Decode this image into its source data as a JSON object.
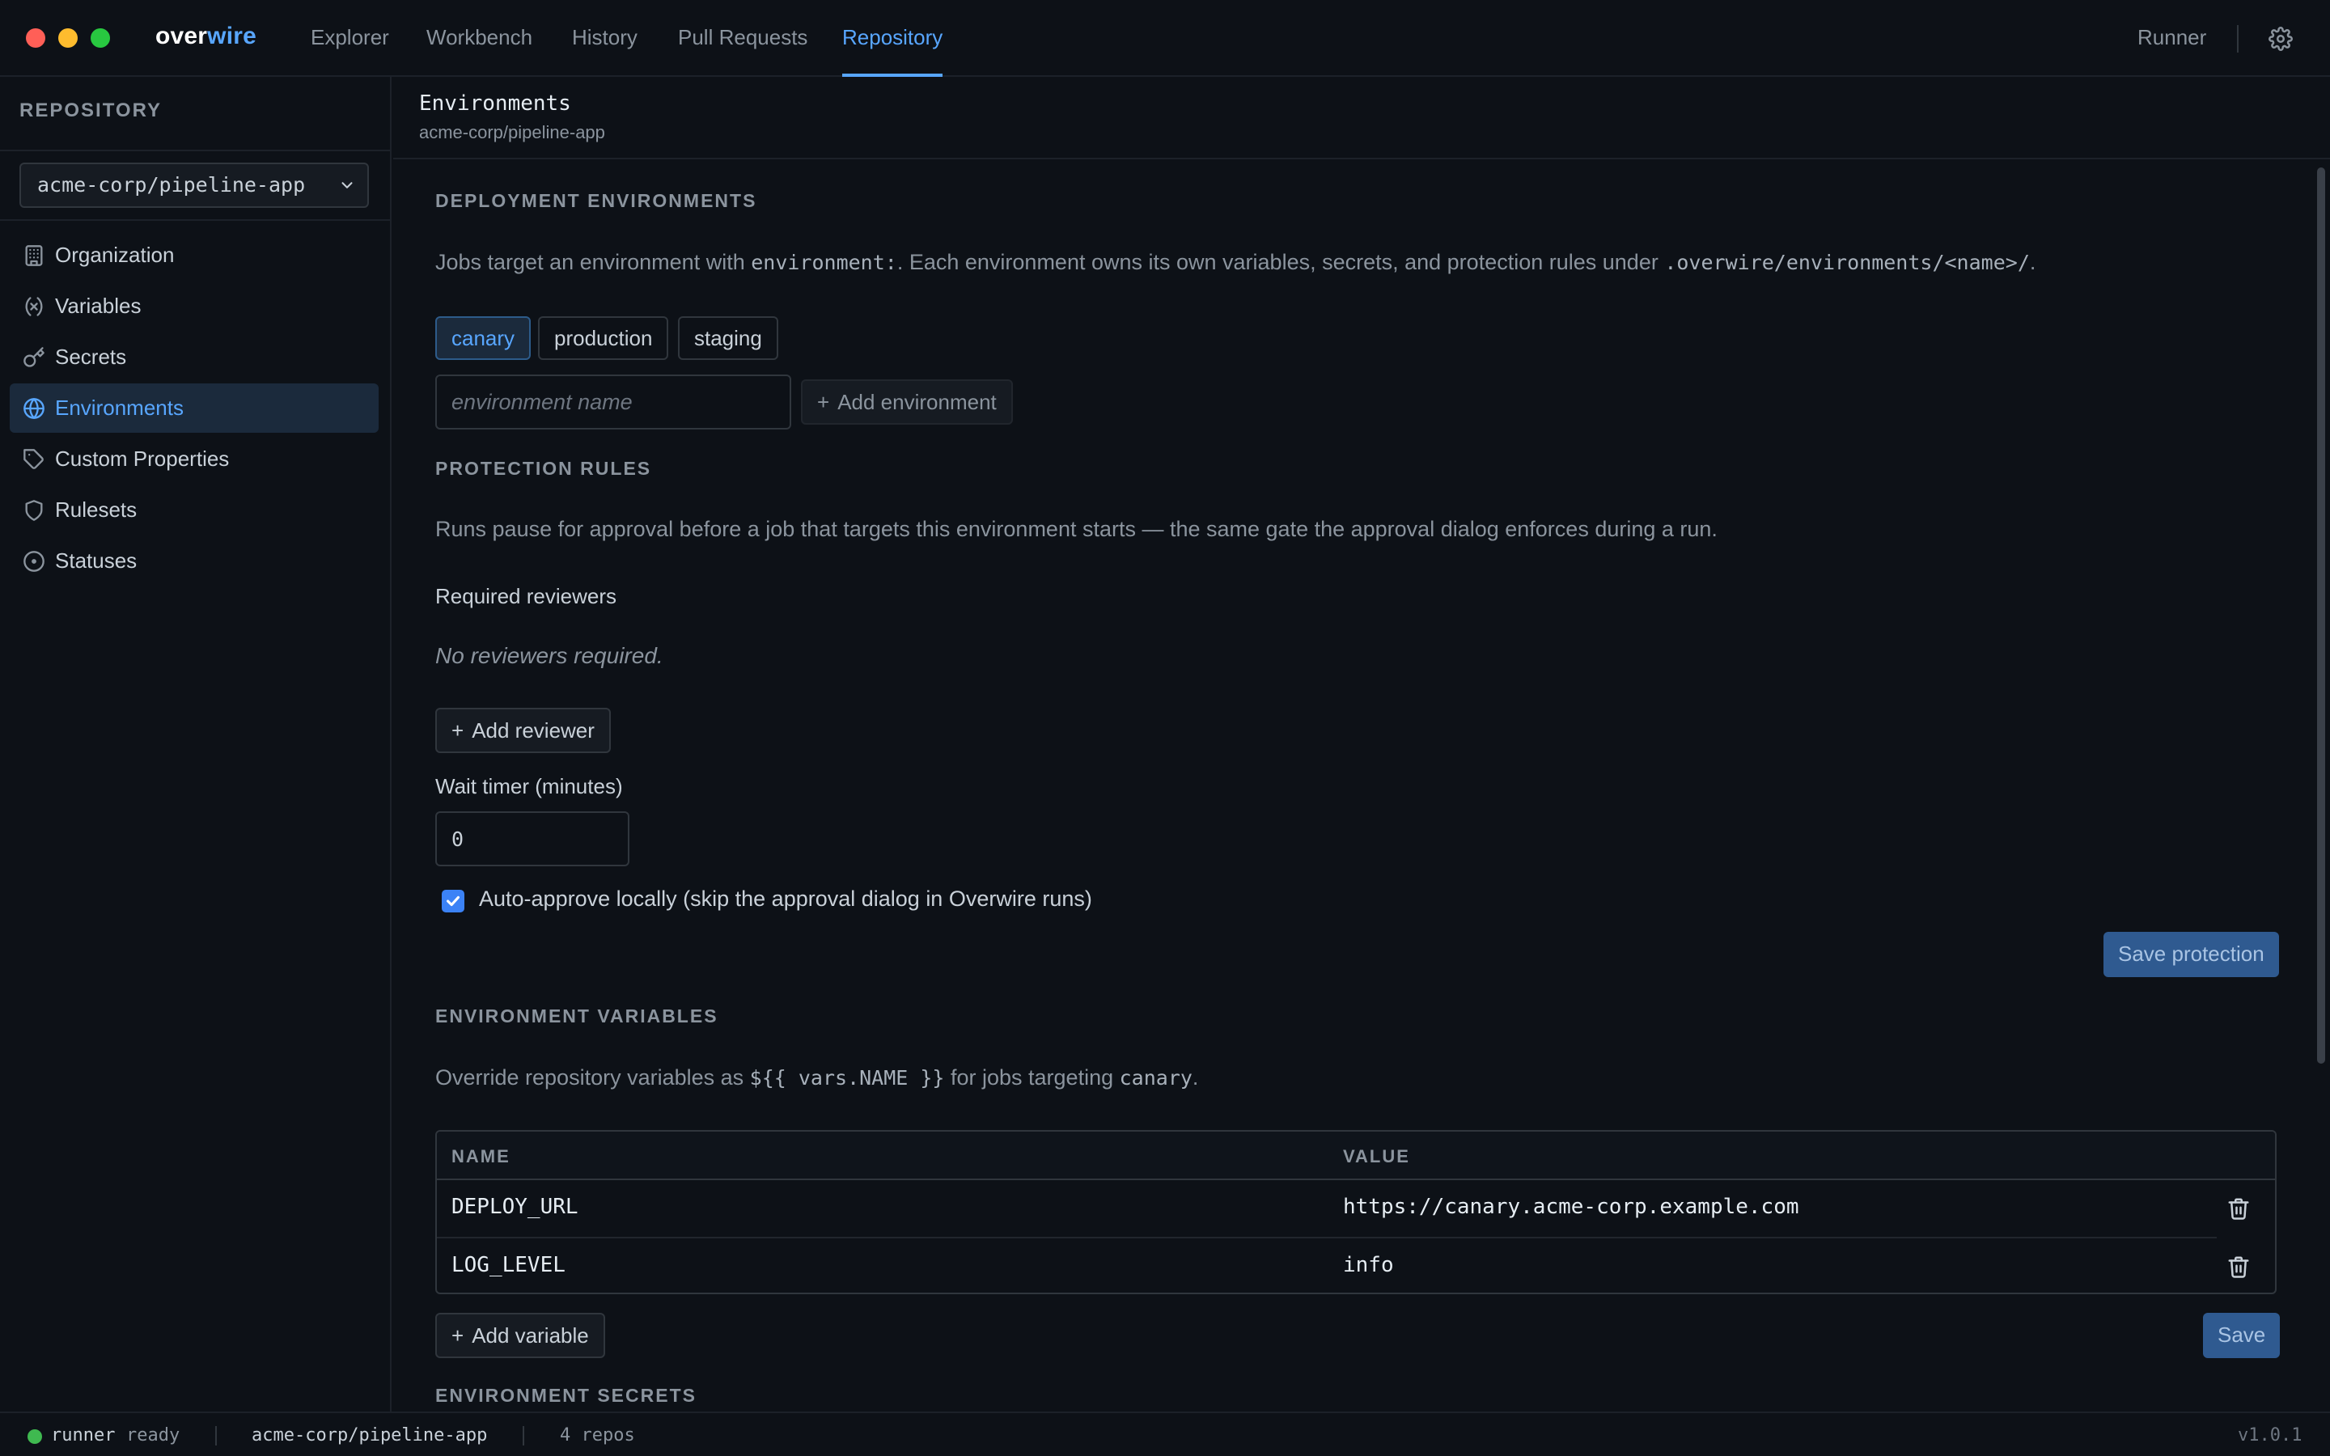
{
  "app": {
    "logo_a": "over",
    "logo_b": "wire"
  },
  "nav": {
    "tabs": [
      {
        "label": "Explorer"
      },
      {
        "label": "Workbench"
      },
      {
        "label": "History"
      },
      {
        "label": "Pull Requests"
      },
      {
        "label": "Repository"
      }
    ],
    "active_tab": "Repository",
    "runner_label": "Runner"
  },
  "sidebar": {
    "heading": "REPOSITORY",
    "repo_select": "acme-corp/pipeline-app",
    "items": [
      {
        "label": "Organization",
        "icon": "building-icon"
      },
      {
        "label": "Variables",
        "icon": "variable-icon"
      },
      {
        "label": "Secrets",
        "icon": "key-icon"
      },
      {
        "label": "Environments",
        "icon": "globe-icon"
      },
      {
        "label": "Custom Properties",
        "icon": "tag-icon"
      },
      {
        "label": "Rulesets",
        "icon": "shield-icon"
      },
      {
        "label": "Statuses",
        "icon": "circle-dot-icon"
      }
    ],
    "active_item": "Environments"
  },
  "page": {
    "title": "Environments",
    "subtitle": "acme-corp/pipeline-app"
  },
  "deployment": {
    "heading": "DEPLOYMENT ENVIRONMENTS",
    "desc_1": "Jobs target an environment with ",
    "desc_code_1": "environment:",
    "desc_2": ". Each environment owns its own variables, secrets, and protection rules under ",
    "desc_code_2": ".overwire/environments/<name>/",
    "desc_3": ".",
    "environments": [
      "canary",
      "production",
      "staging"
    ],
    "selected": "canary",
    "name_placeholder": "environment name",
    "add_label": "Add environment"
  },
  "protection": {
    "heading": "PROTECTION RULES",
    "desc": "Runs pause for approval before a job that targets this environment starts — the same gate the approval dialog enforces during a run.",
    "reviewers_label": "Required reviewers",
    "no_reviewers": "No reviewers required.",
    "add_reviewer_label": "Add reviewer",
    "wait_timer_label": "Wait timer (minutes)",
    "wait_timer_value": "0",
    "auto_approve_label": "Auto-approve locally (skip the approval dialog in Overwire runs)",
    "auto_approve_checked": true,
    "save_label": "Save protection"
  },
  "env_vars": {
    "heading": "ENVIRONMENT VARIABLES",
    "desc_1": "Override repository variables as ",
    "desc_code_1": "${{ vars.NAME }}",
    "desc_2": " for jobs targeting ",
    "desc_code_2": "canary",
    "desc_3": ".",
    "columns": [
      "NAME",
      "VALUE"
    ],
    "rows": [
      {
        "name": "DEPLOY_URL",
        "value": "https://canary.acme-corp.example.com"
      },
      {
        "name": "LOG_LEVEL",
        "value": "info"
      }
    ],
    "add_label": "Add variable",
    "save_label": "Save"
  },
  "env_secrets": {
    "heading": "ENVIRONMENT SECRETS"
  },
  "statusbar": {
    "runner": "runner",
    "runner_state": "ready",
    "repo": "acme-corp/pipeline-app",
    "repo_count": "4 repos",
    "version": "v1.0.1"
  },
  "colors": {
    "background": "#0d1117",
    "accent": "#58a6ff",
    "primary_button": "#2f5a90",
    "status_ok": "#3fb950"
  }
}
